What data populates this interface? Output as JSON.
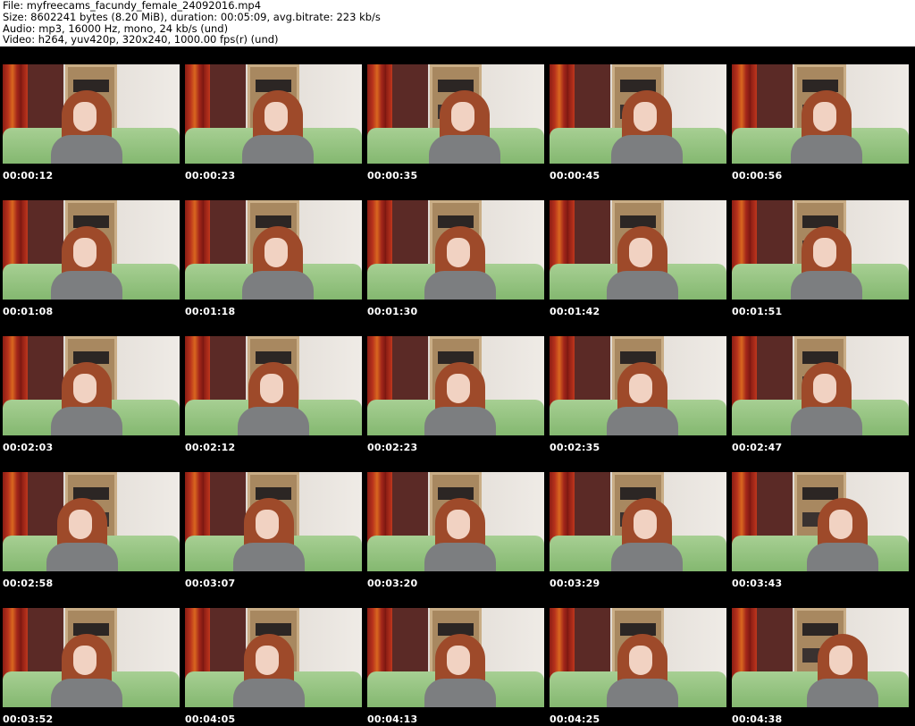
{
  "header": {
    "file_line": "File: myfreecams_facundy_female_24092016.mp4",
    "size_line": "Size: 8602241 bytes (8.20 MiB), duration: 00:05:09, avg.bitrate: 223 kb/s",
    "audio_line": "Audio: mp3, 16000 Hz, mono, 24 kb/s (und)",
    "video_line": "Video: h264, yuv420p, 320x240, 1000.00 fps(r) (und)"
  },
  "thumbnails": [
    {
      "timestamp": "00:00:12"
    },
    {
      "timestamp": "00:00:23"
    },
    {
      "timestamp": "00:00:35"
    },
    {
      "timestamp": "00:00:45"
    },
    {
      "timestamp": "00:00:56"
    },
    {
      "timestamp": "00:01:08"
    },
    {
      "timestamp": "00:01:18"
    },
    {
      "timestamp": "00:01:30"
    },
    {
      "timestamp": "00:01:42"
    },
    {
      "timestamp": "00:01:51"
    },
    {
      "timestamp": "00:02:03"
    },
    {
      "timestamp": "00:02:12"
    },
    {
      "timestamp": "00:02:23"
    },
    {
      "timestamp": "00:02:35"
    },
    {
      "timestamp": "00:02:47"
    },
    {
      "timestamp": "00:02:58"
    },
    {
      "timestamp": "00:03:07"
    },
    {
      "timestamp": "00:03:20"
    },
    {
      "timestamp": "00:03:29"
    },
    {
      "timestamp": "00:03:43"
    },
    {
      "timestamp": "00:03:52"
    },
    {
      "timestamp": "00:04:05"
    },
    {
      "timestamp": "00:04:13"
    },
    {
      "timestamp": "00:04:25"
    },
    {
      "timestamp": "00:04:38"
    }
  ]
}
